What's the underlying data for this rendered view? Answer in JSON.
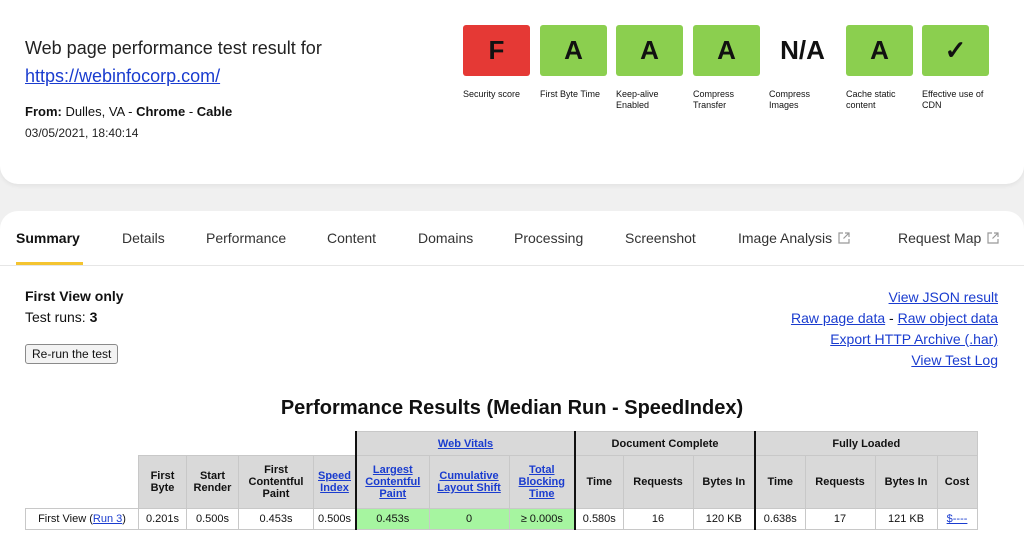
{
  "header": {
    "title": "Web page performance test result for",
    "url": "https://webinfocorp.com/",
    "from_label": "From:",
    "from_location": "Dulles, VA",
    "from_sep1": "-",
    "from_browser": "Chrome",
    "from_sep2": "-",
    "from_connection": "Cable",
    "date": "03/05/2021, 18:40:14"
  },
  "grades": [
    {
      "value": "F",
      "label": "Security score",
      "status": "fail"
    },
    {
      "value": "A",
      "label": "First Byte Time",
      "status": "pass"
    },
    {
      "value": "A",
      "label": "Keep-alive Enabled",
      "status": "pass"
    },
    {
      "value": "A",
      "label": "Compress Transfer",
      "status": "pass"
    },
    {
      "value": "N/A",
      "label": "Compress Images",
      "status": "none"
    },
    {
      "value": "A",
      "label": "Cache static content",
      "status": "pass"
    },
    {
      "value": "✓",
      "label": "Effective use of CDN",
      "status": "pass"
    }
  ],
  "tabs": [
    "Summary",
    "Details",
    "Performance",
    "Content",
    "Domains",
    "Processing",
    "Screenshot",
    "Image Analysis",
    "Request Map"
  ],
  "summary": {
    "view_label": "First View only",
    "runs_label": "Test runs:",
    "runs_value": "3",
    "rerun_button": "Re-run the test"
  },
  "links": {
    "json": "View JSON result",
    "raw_page": "Raw page data",
    "sep": "-",
    "raw_object": "Raw object data",
    "har": "Export HTTP Archive (.har)",
    "log": "View Test Log"
  },
  "perf_title": "Performance Results (Median Run - SpeedIndex)",
  "table": {
    "groups": {
      "web_vitals": "Web Vitals",
      "doc_complete": "Document Complete",
      "fully_loaded": "Fully Loaded"
    },
    "headers": {
      "first_byte": "First Byte",
      "start_render": "Start Render",
      "fcp": "First Contentful Paint",
      "speed_index": "Speed Index",
      "lcp": "Largest Contentful Paint",
      "cls": "Cumulative Layout Shift",
      "tbt": "Total Blocking Time",
      "doc_time": "Time",
      "doc_requests": "Requests",
      "doc_bytes": "Bytes In",
      "full_time": "Time",
      "full_requests": "Requests",
      "full_bytes": "Bytes In",
      "cost": "Cost"
    },
    "row": {
      "label": "First View (",
      "run_link": "Run 3",
      "label_end": ")",
      "first_byte": "0.201s",
      "start_render": "0.500s",
      "fcp": "0.453s",
      "speed_index": "0.500s",
      "lcp": "0.453s",
      "cls": "0",
      "tbt": "≥ 0.000s",
      "doc_time": "0.580s",
      "doc_requests": "16",
      "doc_bytes": "120 KB",
      "full_time": "0.638s",
      "full_requests": "17",
      "full_bytes": "121 KB",
      "cost": "$----"
    }
  },
  "colors": {
    "grade_fail": "#e53935",
    "grade_pass": "#8bcf4f",
    "vital_good": "#a6f5a0",
    "link": "#1a3ccf",
    "tab_accent": "#f4c430"
  }
}
